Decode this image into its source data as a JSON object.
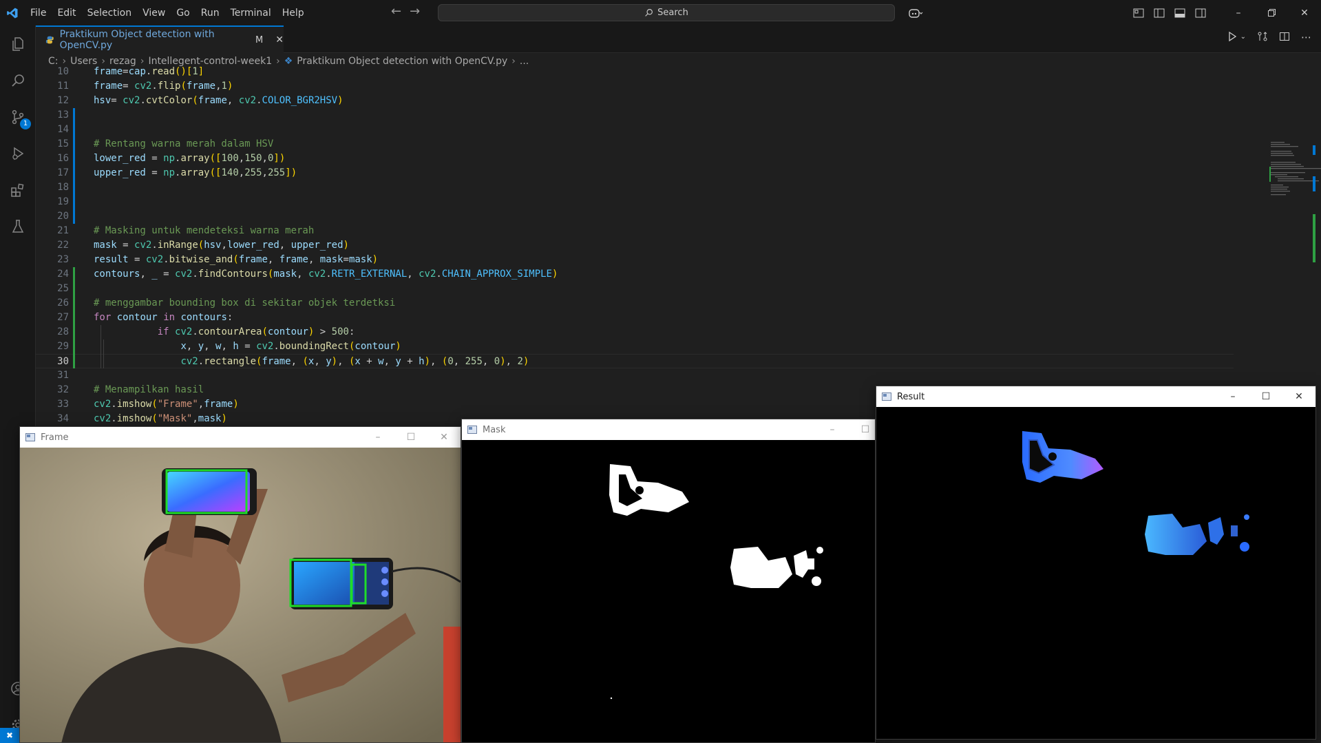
{
  "menu": [
    "File",
    "Edit",
    "Selection",
    "View",
    "Go",
    "Run",
    "Terminal",
    "Help"
  ],
  "search": {
    "label": "Search"
  },
  "activity": {
    "source_control_badge": "1"
  },
  "tab": {
    "title": "Praktikum Object detection with OpenCV.py",
    "modified": "M"
  },
  "breadcrumb": [
    "C:",
    "Users",
    "rezag",
    "Intellegent-control-week1",
    "Praktikum  Object detection with OpenCV.py",
    "..."
  ],
  "code": {
    "active_line": 30,
    "lines": [
      {
        "n": 10,
        "text": "frame=cap.read()[1]"
      },
      {
        "n": 11,
        "text": "frame= cv2.flip(frame,1)"
      },
      {
        "n": 12,
        "text": "hsv= cv2.cvtColor(frame, cv2.COLOR_BGR2HSV)"
      },
      {
        "n": 13,
        "text": ""
      },
      {
        "n": 14,
        "text": ""
      },
      {
        "n": 15,
        "text": "# Rentang warna merah dalam HSV"
      },
      {
        "n": 16,
        "text": "lower_red = np.array([100,150,0])"
      },
      {
        "n": 17,
        "text": "upper_red = np.array([140,255,255])"
      },
      {
        "n": 18,
        "text": ""
      },
      {
        "n": 19,
        "text": ""
      },
      {
        "n": 20,
        "text": ""
      },
      {
        "n": 21,
        "text": "# Masking untuk mendeteksi warna merah"
      },
      {
        "n": 22,
        "text": "mask = cv2.inRange(hsv,lower_red, upper_red)"
      },
      {
        "n": 23,
        "text": "result = cv2.bitwise_and(frame, frame, mask=mask)"
      },
      {
        "n": 24,
        "text": "contours, _ = cv2.findContours(mask, cv2.RETR_EXTERNAL, cv2.CHAIN_APPROX_SIMPLE)"
      },
      {
        "n": 25,
        "text": ""
      },
      {
        "n": 26,
        "text": "# menggambar bounding box di sekitar objek terdetksi"
      },
      {
        "n": 27,
        "text": "for contour in contours:"
      },
      {
        "n": 28,
        "text": "if cv2.contourArea(contour) > 500:"
      },
      {
        "n": 29,
        "text": "x, y, w, h = cv2.boundingRect(contour)"
      },
      {
        "n": 30,
        "text": "cv2.rectangle(frame, (x, y), (x + w, y + h), (0, 255, 0), 2)"
      },
      {
        "n": 31,
        "text": ""
      },
      {
        "n": 32,
        "text": "# Menampilkan hasil"
      },
      {
        "n": 33,
        "text": "cv2.imshow(\"Frame\",frame)"
      },
      {
        "n": 34,
        "text": "cv2.imshow(\"Mask\",mask)"
      }
    ]
  },
  "windows": {
    "frame": {
      "title": "Frame"
    },
    "mask": {
      "title": "Mask"
    },
    "result": {
      "title": "Result"
    }
  },
  "colors": {
    "accent": "#0078d4",
    "bbox": "#1fdc2a"
  }
}
